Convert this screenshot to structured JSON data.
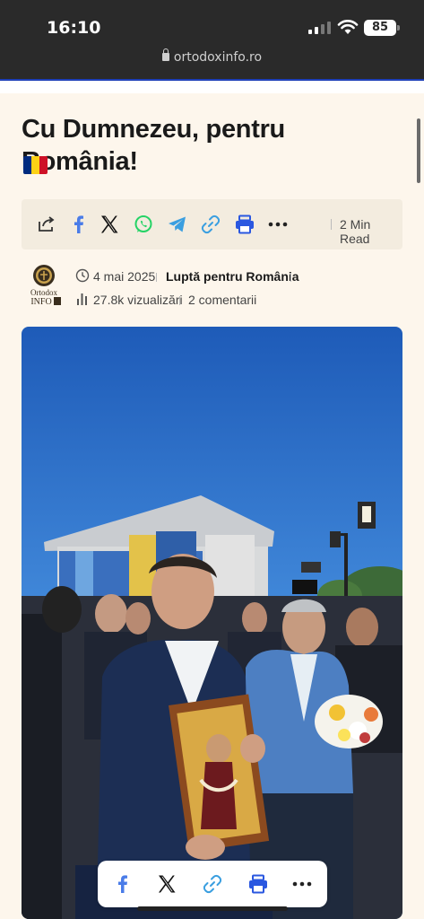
{
  "status": {
    "time": "16:10",
    "battery": "85"
  },
  "browser": {
    "url": "ortodoxinfo.ro"
  },
  "article": {
    "title": "Cu Dumnezeu, pentru România!",
    "flag_colors": [
      "#002b7f",
      "#fcd116",
      "#ce1126"
    ]
  },
  "share": {
    "icons": [
      "share-icon",
      "facebook-icon",
      "x-icon",
      "whatsapp-icon",
      "telegram-icon",
      "link-icon",
      "print-icon",
      "more-icon"
    ],
    "read_time": "2 Min Read"
  },
  "meta": {
    "logo_text": [
      "Ortodox",
      "INFO"
    ],
    "date": "4 mai 2025",
    "category": "Luptă pentru România",
    "views": "27.8k vizualizări",
    "comments": "2 comentarii"
  },
  "floating_share": {
    "icons": [
      "facebook-icon",
      "x-icon",
      "link-icon",
      "print-icon",
      "more-icon"
    ]
  },
  "colors": {
    "facebook": "#4a7ce8",
    "x": "#111111",
    "whatsapp": "#25d366",
    "telegram": "#3b9fe0",
    "link": "#3b9fe0",
    "print": "#2a57e0",
    "accent": "#1e3fb8"
  }
}
